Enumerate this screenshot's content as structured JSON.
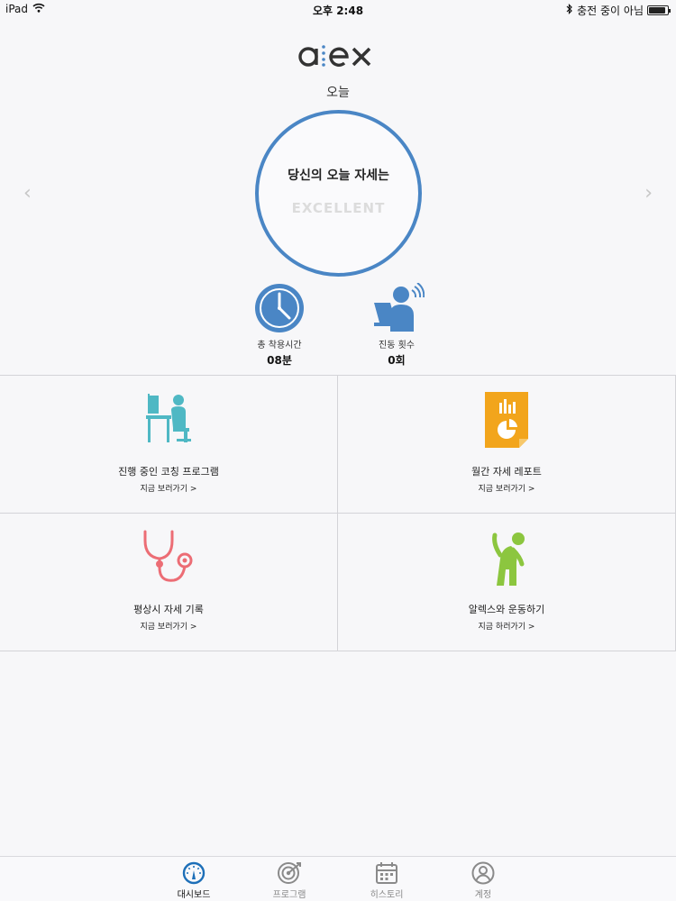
{
  "status_bar": {
    "device": "iPad",
    "time": "오후 2:48",
    "charging": "충전 중이 아님",
    "battery_level_percent": 90
  },
  "header": {
    "logo_text": "alex",
    "today_label": "오늘"
  },
  "posture": {
    "title": "당신의 오늘 자세는",
    "value": "EXCELLENT"
  },
  "navigation": {
    "prev": "‹",
    "next": "›"
  },
  "stats": {
    "usage_label": "총 착용시간",
    "usage_value": "08분",
    "vibration_label": "진동 횟수",
    "vibration_value": "0회"
  },
  "cards": [
    {
      "title": "진행 중인 코칭 프로그램",
      "link": "지금 보러가기 >"
    },
    {
      "title": "월간 자세 레포트",
      "link": "지금 보러가기 >"
    },
    {
      "title": "평상시 자세 기록",
      "link": "지금 보러가기 >"
    },
    {
      "title": "알렉스와 운동하기",
      "link": "지금 하러가기 >"
    }
  ],
  "tabs": [
    {
      "label": "대시보드"
    },
    {
      "label": "프로그램"
    },
    {
      "label": "히스토리"
    },
    {
      "label": "계정"
    }
  ],
  "colors": {
    "accent_blue": "#4a86c5",
    "desk_teal": "#4fb8c4",
    "report_orange": "#f2a51c",
    "stethoscope_red": "#ec6d75",
    "exercise_green": "#8cc63f"
  }
}
